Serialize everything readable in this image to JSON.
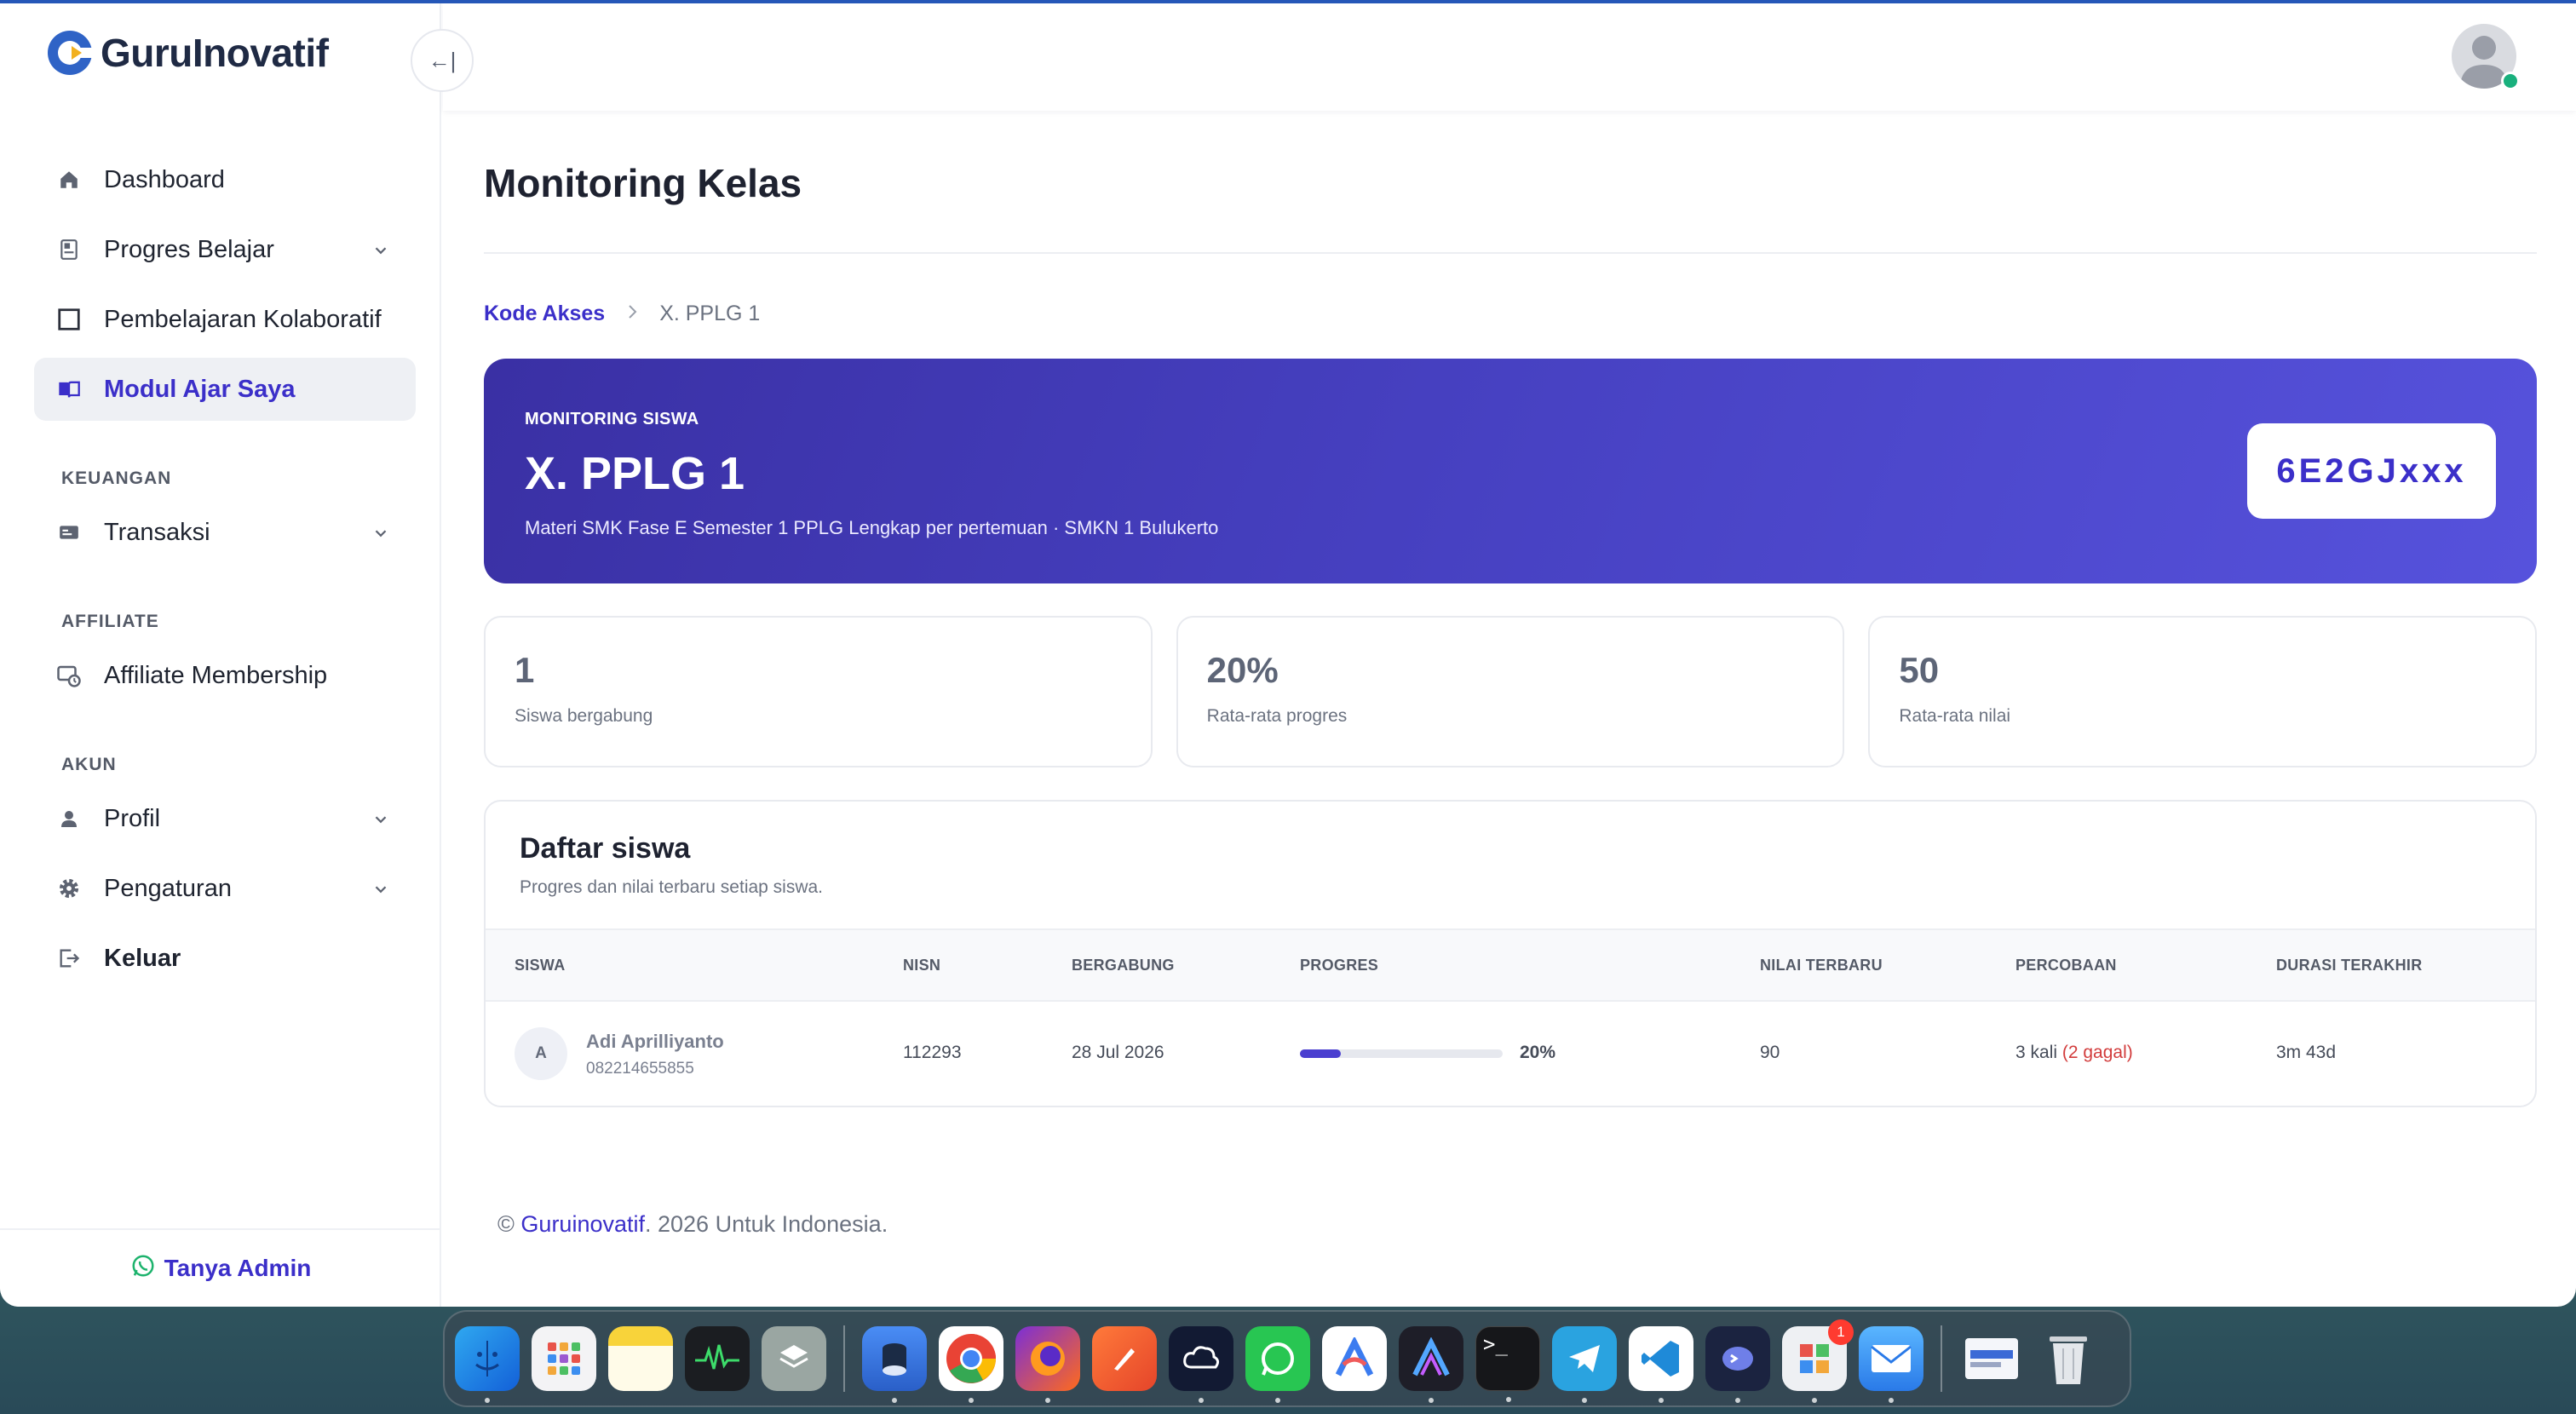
{
  "brand": {
    "name": "GuruInovatif"
  },
  "sidebar": {
    "collapse_icon": "←|",
    "items": [
      {
        "label": "Dashboard",
        "icon": "home-icon"
      },
      {
        "label": "Progres Belajar",
        "icon": "book-progress-icon"
      },
      {
        "label": "Pembelajaran Kolaboratif",
        "icon": "square-icon"
      },
      {
        "label": "Modul Ajar Saya",
        "icon": "open-book-icon",
        "active": true
      }
    ],
    "sections": [
      {
        "title": "KEUANGAN",
        "items": [
          {
            "label": "Transaksi",
            "icon": "card-icon"
          }
        ]
      },
      {
        "title": "AFFILIATE",
        "items": [
          {
            "label": "Affiliate Membership",
            "icon": "affiliate-icon"
          }
        ]
      },
      {
        "title": "AKUN",
        "items": [
          {
            "label": "Profil",
            "icon": "user-icon"
          },
          {
            "label": "Pengaturan",
            "icon": "gear-icon"
          },
          {
            "label": "Keluar",
            "icon": "logout-icon"
          }
        ]
      }
    ],
    "footer_label": "Tanya Admin"
  },
  "page": {
    "title": "Monitoring Kelas",
    "breadcrumb": {
      "link": "Kode Akses",
      "separator": ">",
      "current": "X. PPLG 1"
    }
  },
  "hero": {
    "kicker": "MONITORING SISWA",
    "title": "X. PPLG 1",
    "subtitle": "Materi SMK Fase E Semester 1 PPLG Lengkap per pertemuan · SMKN 1 Bulukerto",
    "code": "6E2GJxxx"
  },
  "stats": [
    {
      "value": "1",
      "label": "Siswa bergabung"
    },
    {
      "value": "20%",
      "label": "Rata-rata progres"
    },
    {
      "value": "50",
      "label": "Rata-rata nilai"
    }
  ],
  "students": {
    "title": "Daftar siswa",
    "subtitle": "Progres dan nilai terbaru setiap siswa.",
    "columns": [
      "SISWA",
      "NISN",
      "BERGABUNG",
      "PROGRES",
      "NILAI TERBARU",
      "PERCOBAAN",
      "DURASI TERAKHIR"
    ],
    "rows": [
      {
        "initial": "A",
        "name": "Adi Aprilliyanto",
        "phone": "082214655855",
        "nisn": "112293",
        "joined": "28 Jul 2026",
        "progress": 20,
        "progress_label": "20%",
        "score": "90",
        "attempts": "3 kali",
        "failed": "(2 gagal)",
        "duration": "3m 43d"
      }
    ]
  },
  "footer": {
    "prefix": "©",
    "link": "Guruinovatif",
    "suffix": ". 2026 Untuk Indonesia."
  },
  "dock": {
    "badge": "1",
    "icons": [
      "finder-icon",
      "launchpad-icon",
      "notes-icon",
      "activity-monitor-icon",
      "layers-icon",
      "app-icon",
      "chrome-icon",
      "firefox-icon",
      "pen-icon",
      "cloud-chat-icon",
      "whatsapp-icon",
      "arc-icon",
      "affinity-icon",
      "terminal-icon",
      "telegram-icon",
      "vscode-icon",
      "prompt-icon",
      "store-icon",
      "mail-icon",
      "preview-icon",
      "trash-icon"
    ]
  },
  "colors": {
    "accent": "#3b2fc9",
    "hero_start": "#3a30a4",
    "hero_end": "#5652dc",
    "fail": "#d23c3c",
    "online": "#19b07d"
  }
}
